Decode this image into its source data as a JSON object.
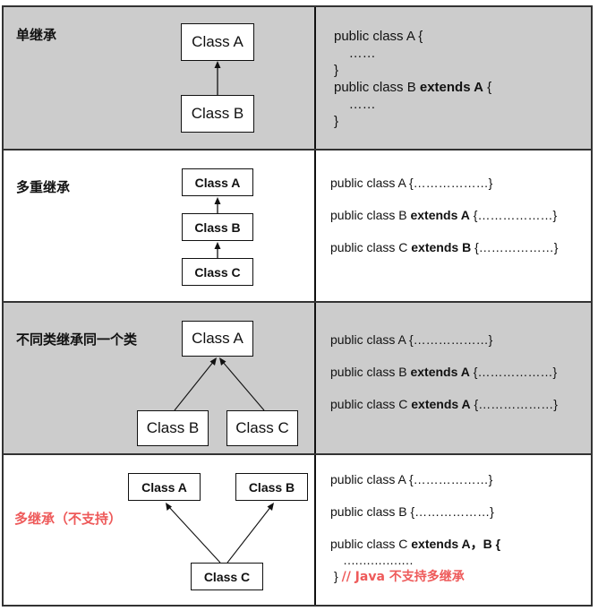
{
  "colors": {
    "gray_row": "#cccccc",
    "white_row": "#ffffff",
    "border": "#111111",
    "warning_red": "#ee5a5a"
  },
  "rows": [
    {
      "title": "单继承",
      "boxes": [
        "Class A",
        "Class B"
      ],
      "relations": [
        {
          "from": "Class B",
          "to": "Class A"
        }
      ],
      "code": {
        "line1": "public class A {",
        "line2": "……",
        "line3": "}",
        "line4_plain": "public class B ",
        "line4_bold": "extends A",
        "line4_tail": " {",
        "line5": "……",
        "line6": "}"
      }
    },
    {
      "title": "多重继承",
      "boxes": [
        "Class A",
        "Class B",
        "Class C"
      ],
      "relations": [
        {
          "from": "Class B",
          "to": "Class A"
        },
        {
          "from": "Class C",
          "to": "Class B"
        }
      ],
      "code": {
        "line1": "public class A {………………}",
        "line2_plain": "public class B ",
        "line2_bold": "extends A",
        "line2_tail": " {………………}",
        "line3_plain": "public class C ",
        "line3_bold": "extends B",
        "line3_tail": " {………………}"
      }
    },
    {
      "title": "不同类继承同一个类",
      "boxes": [
        "Class A",
        "Class B",
        "Class C"
      ],
      "relations": [
        {
          "from": "Class B",
          "to": "Class A"
        },
        {
          "from": "Class C",
          "to": "Class A"
        }
      ],
      "code": {
        "line1": "public class A {………………}",
        "line2_plain": "public class B ",
        "line2_bold": "extends A",
        "line2_tail": " {………………}",
        "line3_plain": "public class C ",
        "line3_bold": "extends A",
        "line3_tail": " {………………}"
      }
    },
    {
      "title": "多继承（不支持）",
      "boxes": [
        "Class A",
        "Class B",
        "Class C"
      ],
      "relations": [
        {
          "from": "Class C",
          "to": "Class A"
        },
        {
          "from": "Class C",
          "to": "Class B"
        }
      ],
      "code": {
        "line1": "public class A {………………}",
        "line2": "public class B {………………}",
        "line3_plain": "public class C ",
        "line3_bold": "extends A，B {",
        "line4": "………………",
        "line5_brace": "}",
        "line5_comment": "// Java 不支持多继承"
      }
    }
  ]
}
